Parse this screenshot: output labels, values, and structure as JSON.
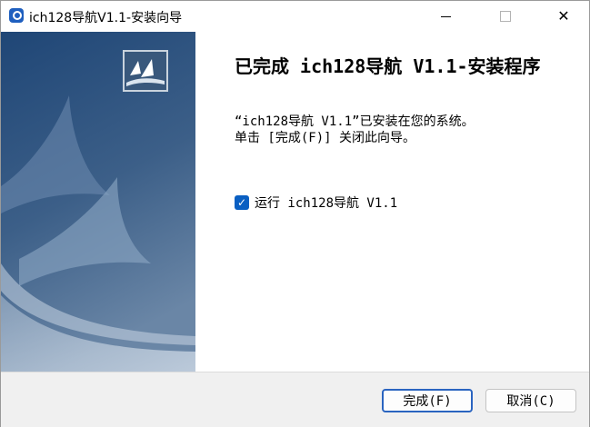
{
  "window": {
    "title": "ich128导航V1.1-安装向导",
    "minimize_symbol": "—",
    "close_symbol": "✕"
  },
  "side_panel": {
    "gradient_top": "#234a78",
    "gradient_bottom": "#5a7898"
  },
  "content": {
    "heading": "已完成 ich128导航 V1.1-安装程序",
    "message_line1": "“ich128导航 V1.1”已安装在您的系统。",
    "message_line2": "单击 [完成(F)] 关闭此向导。",
    "run_checkbox": {
      "label": "运行 ich128导航 V1.1",
      "checked": true,
      "check_symbol": "✓"
    }
  },
  "buttons": {
    "finish_label": "完成(F)",
    "cancel_label": "取消(C)"
  },
  "colors": {
    "accent": "#0a5fc2",
    "finish_border": "#2a64c0"
  }
}
